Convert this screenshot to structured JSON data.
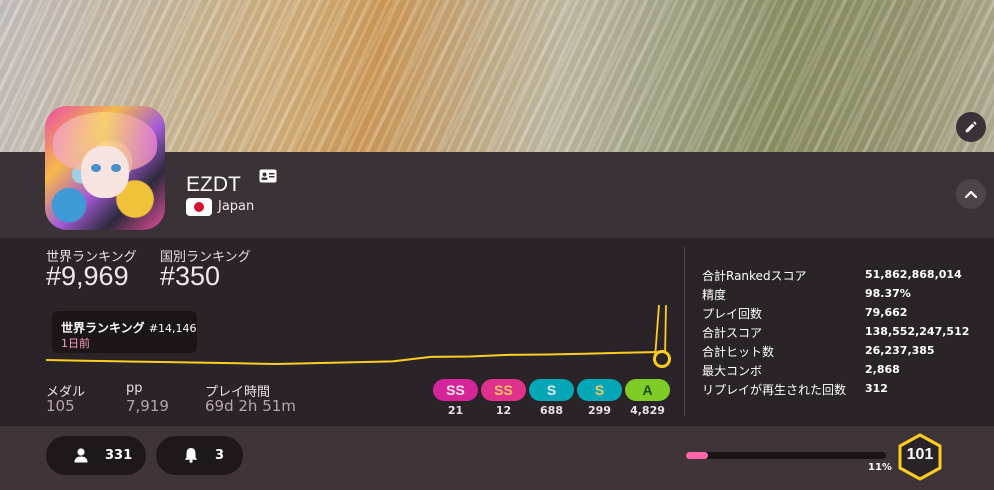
{
  "profile": {
    "username": "EZDT",
    "country": "Japan",
    "country_flag_color": "#d3132f"
  },
  "ranking": {
    "global_label": "世界ランキング",
    "global_value": "#9,969",
    "country_label": "国別ランキング",
    "country_value": "#350"
  },
  "tooltip": {
    "title": "世界ランキング",
    "rank": "#14,146",
    "time": "1日前"
  },
  "chart_data": {
    "type": "line",
    "y_reversed": true,
    "series": [
      {
        "values": [
          13950,
          13990,
          14020,
          14050,
          14080,
          14110,
          14146,
          14100,
          14060,
          14020,
          13800,
          13780,
          13700,
          13680,
          13650,
          13600,
          13560
        ]
      }
    ]
  },
  "summary": {
    "medal_label": "メダル",
    "medal_value": "105",
    "pp_label": "pp",
    "pp_value": "7,919",
    "playtime_label": "プレイ時間",
    "playtime_value": "69d 2h 51m"
  },
  "grades": [
    {
      "label": "SS",
      "count": "21",
      "bg": "#d6249b",
      "fg": "#e7e7e7"
    },
    {
      "label": "SS",
      "count": "12",
      "bg": "#e0318d",
      "fg": "#f7c560"
    },
    {
      "label": "S",
      "count": "688",
      "bg": "#03a7b7",
      "fg": "#e7e7e7"
    },
    {
      "label": "S",
      "count": "299",
      "bg": "#03a7b7",
      "fg": "#f7c560"
    },
    {
      "label": "A",
      "count": "4,829",
      "bg": "#7fcc26",
      "fg": "#1d4a12"
    }
  ],
  "details": [
    {
      "label": "合計Rankedスコア",
      "value": "51,862,868,014"
    },
    {
      "label": "精度",
      "value": "98.37%"
    },
    {
      "label": "プレイ回数",
      "value": "79,662"
    },
    {
      "label": "合計スコア",
      "value": "138,552,247,512"
    },
    {
      "label": "合計ヒット数",
      "value": "26,237,385"
    },
    {
      "label": "最大コンボ",
      "value": "2,868"
    },
    {
      "label": "リプレイが再生された回数",
      "value": "312"
    }
  ],
  "footer": {
    "followers": "331",
    "notifications": "3",
    "level_progress_label": "11%",
    "level_progress": 0.11,
    "level": "101"
  },
  "colors": {
    "accent_pink": "#ff66ab",
    "chart_line": "#ffcc22",
    "level_border": "#ffcc22"
  }
}
